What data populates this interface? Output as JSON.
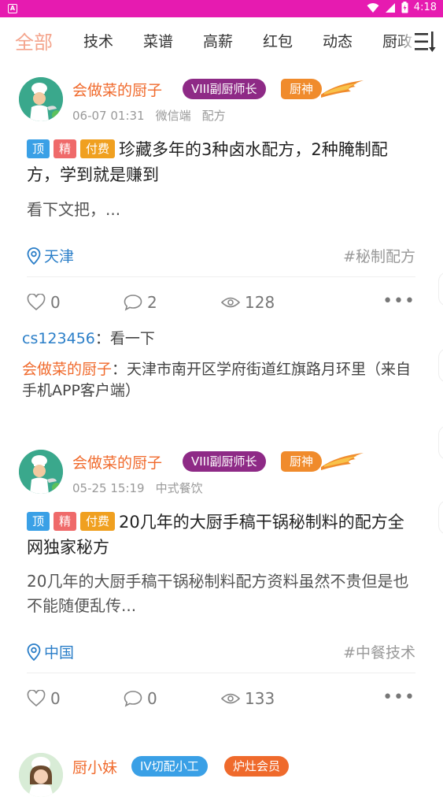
{
  "status_bar": {
    "app_icon_letter": "A",
    "time": "4:18",
    "icons": [
      "wifi-icon",
      "signal-icon",
      "battery-icon"
    ]
  },
  "tabs": {
    "items": [
      "全部",
      "技术",
      "菜谱",
      "高薪",
      "红包",
      "动态",
      "厨政"
    ],
    "active": "全部",
    "active_color": "#f4a48c"
  },
  "posts": [
    {
      "author": "会做菜的厨子",
      "rank_badge": "VIII副厨师长",
      "title_badge": "厨神",
      "date": "06-07 01:31",
      "source": "微信端",
      "category": "配方",
      "tags": [
        "顶",
        "精",
        "付费"
      ],
      "title": "珍藏多年的3种卤水配方，2种腌制配方，学到就是赚到",
      "excerpt": "看下文把，...",
      "location": "天津",
      "hashtag": "#秘制配方",
      "likes": "0",
      "comments": "2",
      "views": "128",
      "replies": [
        {
          "user": "cs123456",
          "sep": "：",
          "text": "看一下"
        },
        {
          "user": "会做菜的厨子",
          "sep": "：",
          "text": "天津市南开区学府街道红旗路月环里（来自手机APP客户端）"
        }
      ]
    },
    {
      "author": "会做菜的厨子",
      "rank_badge": "VIII副厨师长",
      "title_badge": "厨神",
      "date": "05-25 15:19",
      "category": "中式餐饮",
      "tags": [
        "顶",
        "精",
        "付费"
      ],
      "title": "20几年的大厨手稿干锅秘制料的配方全网独家秘方",
      "excerpt": "20几年的大厨手稿干锅秘制料配方资料虽然不贵但是也不能随便乱传...",
      "location": "中国",
      "hashtag": "#中餐技术",
      "likes": "0",
      "comments": "0",
      "views": "133"
    },
    {
      "author": "厨小妹",
      "rank_badge": "IV切配小工",
      "member_badge": "炉灶会员"
    }
  ],
  "colors": {
    "status_bar": "#e61bb0",
    "author": "#f06a2c",
    "link": "#2a7ec8",
    "rank_badge": "#8e2a86",
    "god_badge": "#f08b2c"
  }
}
